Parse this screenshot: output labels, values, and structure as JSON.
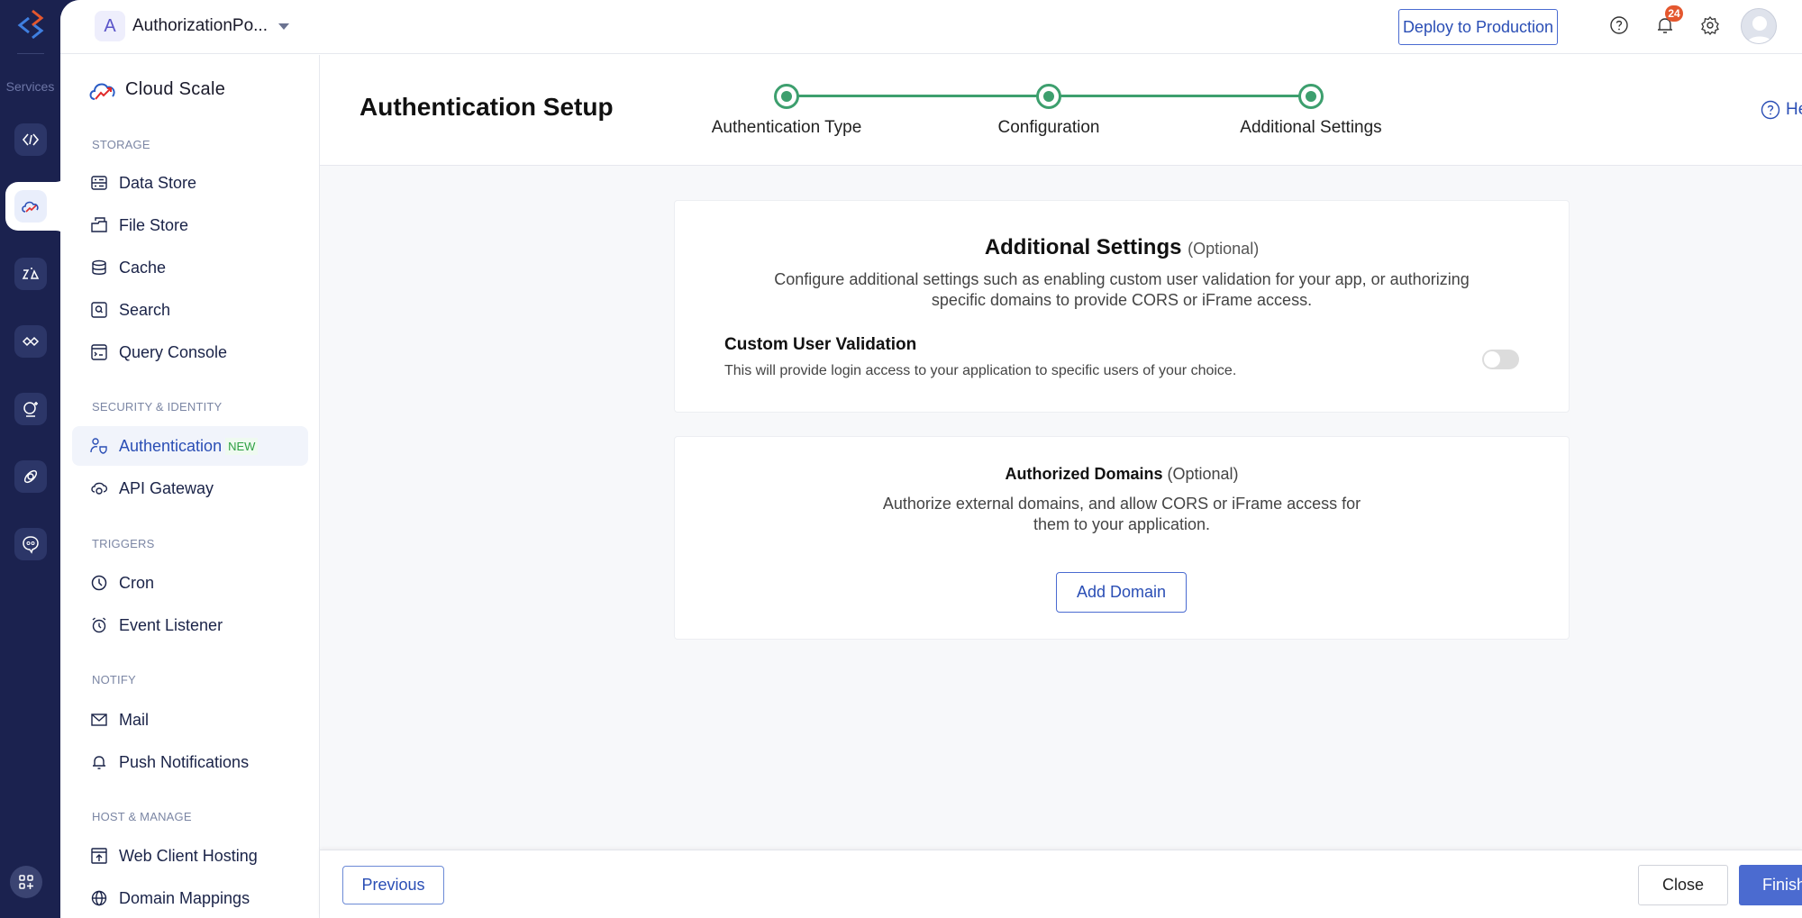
{
  "rail": {
    "label": "Services",
    "items": [
      {
        "name": "code-icon"
      },
      {
        "name": "cloud-scale-icon",
        "active": true
      },
      {
        "name": "zia-icon"
      },
      {
        "name": "integrations-icon"
      },
      {
        "name": "ai-assistant-icon"
      },
      {
        "name": "devops-icon"
      },
      {
        "name": "chatbot-icon"
      }
    ],
    "apps_icon": "apps-add-icon"
  },
  "topbar": {
    "project_initial": "A",
    "project_name": "AuthorizationPo...",
    "deploy_label": "Deploy to Production",
    "notification_count": "24",
    "icons": [
      "help-icon",
      "bell-icon",
      "gear-icon",
      "avatar"
    ]
  },
  "sidebar": {
    "brand": "Cloud Scale",
    "sections": [
      {
        "label": "STORAGE",
        "items": [
          "Data Store",
          "File Store",
          "Cache",
          "Search",
          "Query Console"
        ]
      },
      {
        "label": "SECURITY & IDENTITY",
        "items": [
          "Authentication",
          "API Gateway"
        ]
      },
      {
        "label": "TRIGGERS",
        "items": [
          "Cron",
          "Event Listener"
        ]
      },
      {
        "label": "NOTIFY",
        "items": [
          "Mail",
          "Push Notifications"
        ]
      },
      {
        "label": "HOST & MANAGE",
        "items": [
          "Web Client Hosting",
          "Domain Mappings"
        ]
      }
    ],
    "active_item": "Authentication",
    "new_badge": "NEW"
  },
  "page": {
    "title": "Authentication Setup",
    "help_label": "Help",
    "steps": [
      "Authentication Type",
      "Configuration",
      "Additional Settings"
    ],
    "step_color": "#3d9f6e"
  },
  "additional_settings": {
    "title": "Additional Settings",
    "optional": "(Optional)",
    "desc_line1": "Configure additional settings such as enabling custom user validation for your app, or authorizing",
    "desc_line2": "specific domains to provide CORS or iFrame access.",
    "cuv_title": "Custom User Validation",
    "cuv_desc": "This will provide login access to your application to specific users of your choice.",
    "cuv_enabled": false
  },
  "authorized_domains": {
    "title": "Authorized Domains",
    "optional": "(Optional)",
    "desc_line1": "Authorize external domains, and allow CORS or iFrame access for",
    "desc_line2": "them to your application.",
    "add_label": "Add Domain"
  },
  "footer": {
    "previous_label": "Previous",
    "close_label": "Close",
    "finish_label": "Finish",
    "accent": "#4b6bd0"
  }
}
